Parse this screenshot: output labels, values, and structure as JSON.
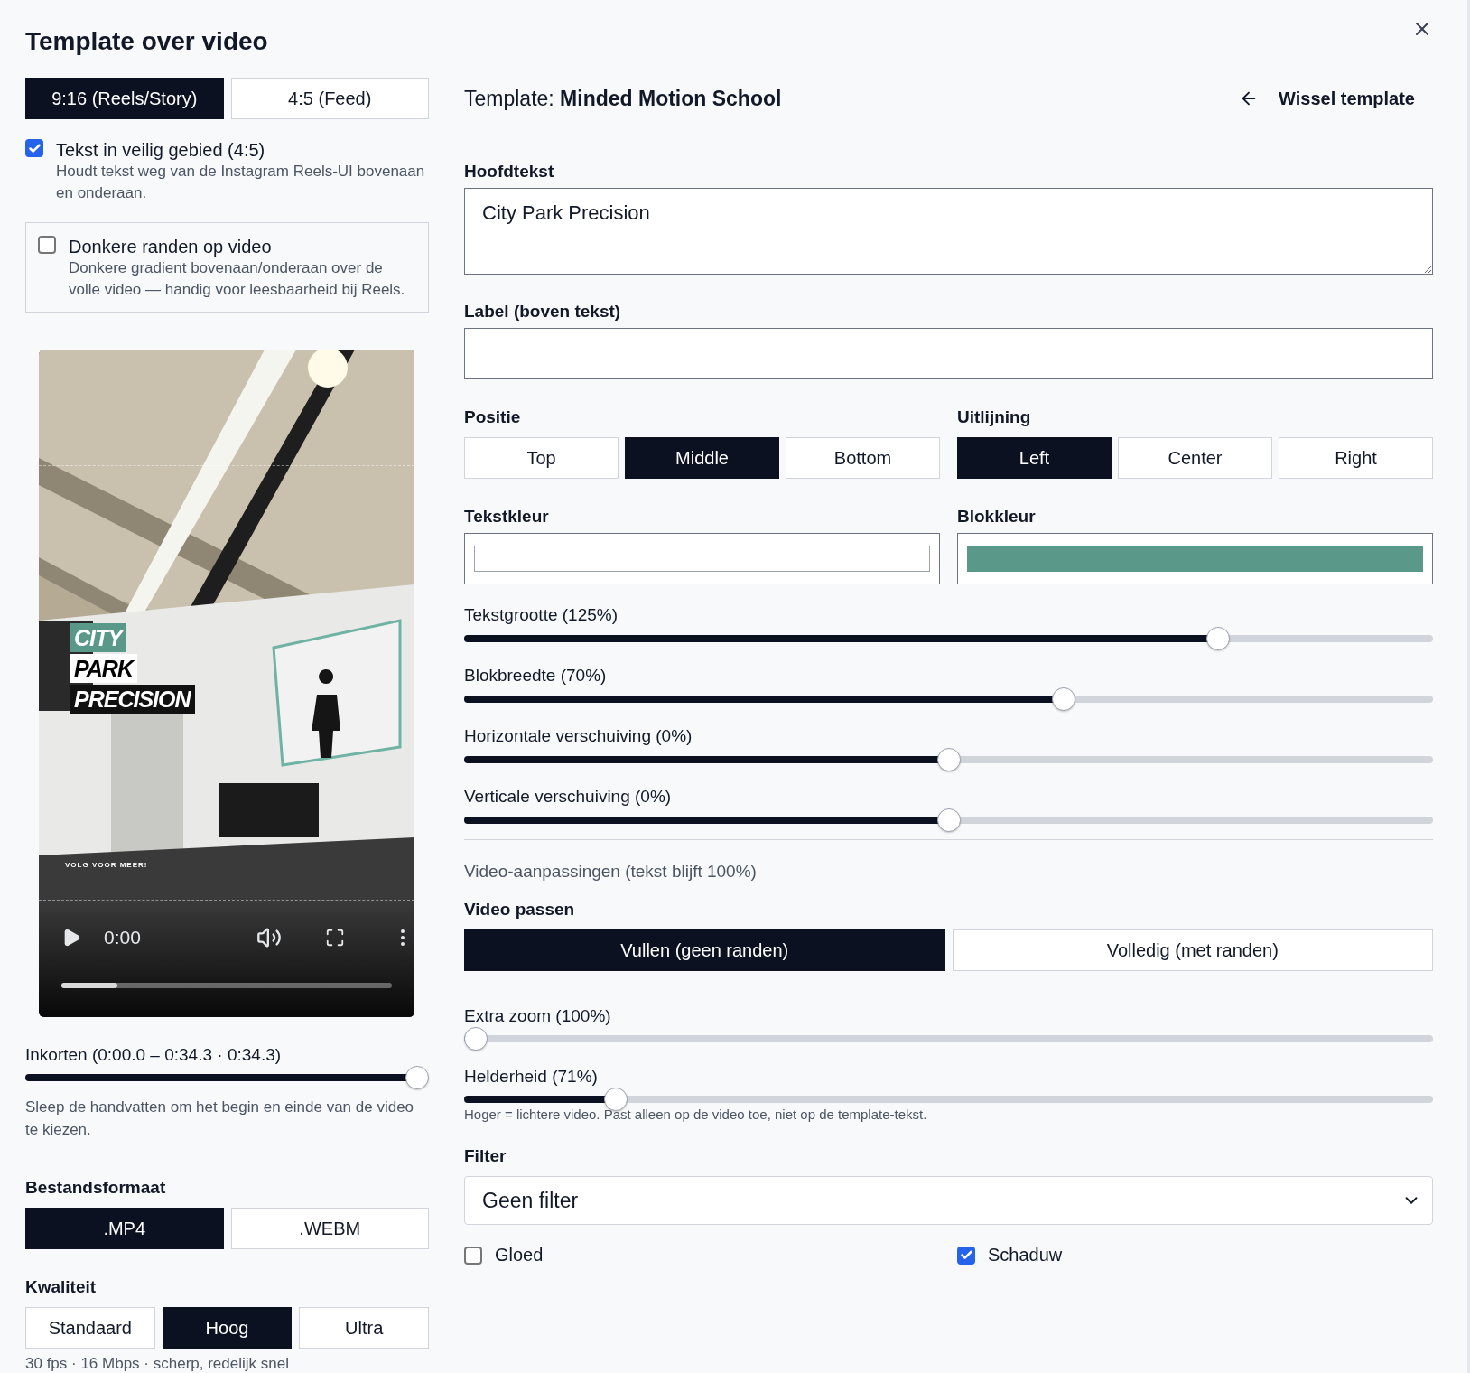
{
  "dialog": {
    "title": "Template over video"
  },
  "aspect_ratios": [
    {
      "label": "9:16 (Reels/Story)",
      "selected": true
    },
    {
      "label": "4:5 (Feed)",
      "selected": false
    }
  ],
  "options": [
    {
      "kind": "plain",
      "label": "Tekst in veilig gebied (4:5)",
      "description": "Houdt tekst weg van de Instagram Reels-UI bovenaan en onderaan.",
      "checked": true
    },
    {
      "kind": "card",
      "label": "Donkere randen op video",
      "description": "Donkere gradient bovenaan/onderaan over de volle video — handig voor leesbaarheid bij Reels.",
      "checked": false
    }
  ],
  "preview": {
    "kind": "picture",
    "overlay_lines": [
      {
        "text": "CITY",
        "kind": "accent"
      },
      {
        "text": "PARK",
        "kind": "light"
      },
      {
        "text": "PRECISION",
        "kind": "dark"
      }
    ],
    "footer": "VOLG VOOR MEER!",
    "time": "0:00",
    "progress": {
      "level": 0.17
    }
  },
  "trim": {
    "label": "Inkorten (0:00.0 – 0:34.3 · 0:34.3)",
    "level": 1,
    "hint": "Sleep de handvatten om het begin en einde van de video te kiezen."
  },
  "file_format": {
    "label": "Bestandsformaat",
    "options": [
      {
        "label": ".MP4",
        "selected": true
      },
      {
        "label": ".WEBM",
        "selected": false
      }
    ]
  },
  "quality": {
    "label": "Kwaliteit",
    "options": [
      {
        "label": "Standaard",
        "selected": false
      },
      {
        "label": "Hoog",
        "selected": true
      },
      {
        "label": "Ultra",
        "selected": false
      }
    ],
    "note": "30 fps · 16 Mbps · scherp, redelijk snel"
  },
  "template": {
    "prefix": "Template:",
    "name": "Minded Motion School",
    "switch": "Wissel template"
  },
  "main_text": {
    "label": "Hoofdtekst",
    "value": "City Park Precision"
  },
  "label_field": {
    "label": "Label (boven tekst)"
  },
  "position": {
    "label": "Positie",
    "options": [
      {
        "label": "Top",
        "selected": false
      },
      {
        "label": "Middle",
        "selected": true
      },
      {
        "label": "Bottom",
        "selected": false
      }
    ]
  },
  "alignment": {
    "label": "Uitlijning",
    "options": [
      {
        "label": "Left",
        "selected": true
      },
      {
        "label": "Center",
        "selected": false
      },
      {
        "label": "Right",
        "selected": false
      }
    ]
  },
  "text_color": {
    "label": "Tekstkleur",
    "color": "#ffffff"
  },
  "block_color": {
    "label": "Blokkleur",
    "color": "#5a998a"
  },
  "sliders": [
    {
      "label": "Tekstgrootte (125%)",
      "level": 0.785
    },
    {
      "label": "Blokbreedte (70%)",
      "level": 0.622
    },
    {
      "label": "Horizontale verschuiving (0%)",
      "level": 0.5
    },
    {
      "label": "Verticale verschuiving (0%)",
      "level": 0.5
    }
  ],
  "video_section": {
    "heading": "Video-aanpassingen (tekst blijft 100%)",
    "fit": {
      "label": "Video passen",
      "options": [
        {
          "label": "Vullen (geen randen)",
          "selected": true
        },
        {
          "label": "Volledig (met randen)",
          "selected": false
        }
      ]
    },
    "sliders": [
      {
        "label": "Extra zoom (100%)",
        "level": 0
      },
      {
        "label": "Helderheid (71%)",
        "level": 0.148
      }
    ],
    "hint": "Hoger = lichtere video. Past alleen op de video toe, niet op de template-tekst.",
    "filter": {
      "label": "Filter",
      "value": "Geen filter"
    },
    "effects": [
      {
        "label": "Gloed",
        "checked": false
      },
      {
        "label": "Schaduw",
        "checked": true
      }
    ]
  }
}
